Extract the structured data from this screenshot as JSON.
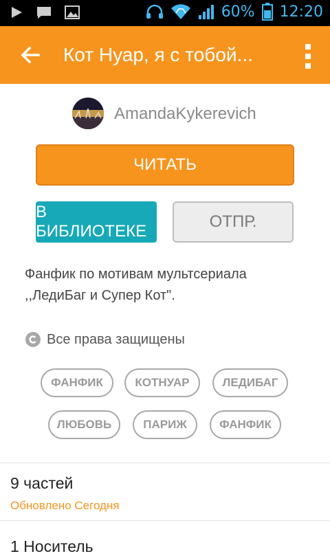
{
  "status_bar": {
    "battery_percent": "60%",
    "time": "12:20",
    "text_color": "#43b7f0"
  },
  "app_bar": {
    "title": "Кот Нуар, я с тобой...",
    "background": "#f7941d"
  },
  "author": {
    "name": "AmandaKykerevich"
  },
  "actions": {
    "read_label": "ЧИТАТЬ",
    "library_label": "В БИБЛИОТЕКЕ",
    "send_label": "ОТПР."
  },
  "description": {
    "line1": "Фанфик по мотивам мультсериала",
    "line2": ",,ЛедиБаг и Супер Кот\"."
  },
  "copyright": {
    "label": "Все права защищены"
  },
  "tags": [
    "ФАНФИК",
    "КОТНУАР",
    "ЛЕДИБАГ",
    "ЛЮБОВЬ",
    "ПАРИЖ",
    "ФАНФИК"
  ],
  "parts": {
    "count_label": "9 частей",
    "updated_label": "Обновлено Сегодня"
  },
  "next_section": {
    "label": "1 Носитель"
  }
}
